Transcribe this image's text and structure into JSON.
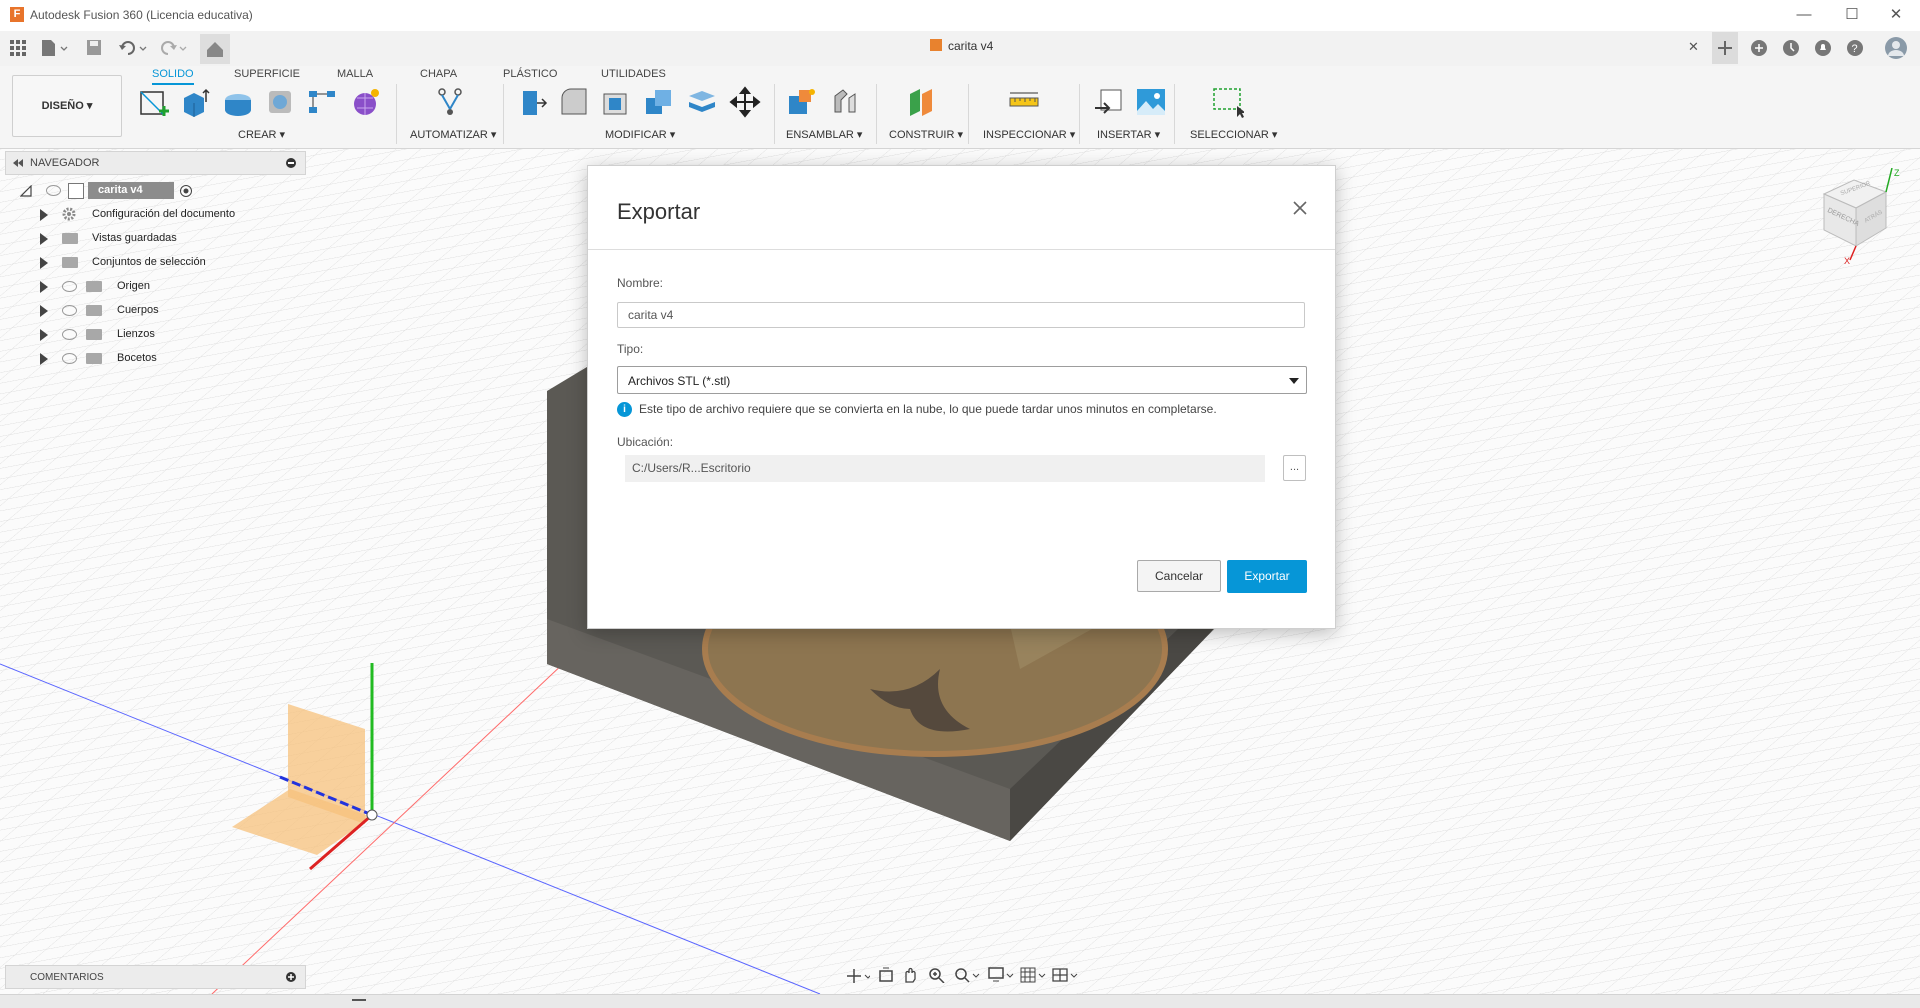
{
  "window": {
    "title": "Autodesk Fusion 360 (Licencia educativa)",
    "logo_letter": "F",
    "minimize": "—",
    "maximize": "☐",
    "close": "✕"
  },
  "doc_tab": {
    "name": "carita v4",
    "close": "✕"
  },
  "ribbon": {
    "workspace": "DISEÑO ▾",
    "tabs": [
      "SOLIDO",
      "SUPERFICIE",
      "MALLA",
      "CHAPA",
      "PLÁSTICO",
      "UTILIDADES"
    ],
    "groups": [
      "CREAR ▾",
      "AUTOMATIZAR ▾",
      "MODIFICAR ▾",
      "ENSAMBLAR ▾",
      "CONSTRUIR ▾",
      "INSPECCIONAR ▾",
      "INSERTAR ▾",
      "SELECCIONAR ▾"
    ]
  },
  "navigator": {
    "title": "NAVEGADOR",
    "root": "carita v4",
    "items": [
      {
        "label": "Configuración del documento",
        "icon": "gear-icon"
      },
      {
        "label": "Vistas guardadas",
        "icon": "folder-icon"
      },
      {
        "label": "Conjuntos de selección",
        "icon": "folder-icon"
      },
      {
        "label": "Origen",
        "icon": "folder-icon"
      },
      {
        "label": "Cuerpos",
        "icon": "folder-icon"
      },
      {
        "label": "Lienzos",
        "icon": "folder-icon"
      },
      {
        "label": "Bocetos",
        "icon": "folder-icon"
      }
    ]
  },
  "comments": {
    "title": "COMENTARIOS"
  },
  "viewcube": {
    "front": "DERECHA",
    "top": "SUPERIOR",
    "side": "ATRÁS",
    "axis_x": "X",
    "axis_z": "Z"
  },
  "dialog": {
    "title": "Exportar",
    "name_label": "Nombre:",
    "name_value": "carita v4",
    "type_label": "Tipo:",
    "type_value": "Archivos STL (*.stl)",
    "info_icon": "i",
    "info_text": "Este tipo de archivo requiere que se convierta en la nube, lo que puede tardar unos minutos en completarse.",
    "location_label": "Ubicación:",
    "location_value": "C:/Users/R...Escritorio",
    "browse_label": "...",
    "cancel_label": "Cancelar",
    "export_label": "Exportar"
  },
  "colors": {
    "accent": "#0696d7",
    "fusion_orange": "#e8742b",
    "model_gray": "#5a5852"
  }
}
